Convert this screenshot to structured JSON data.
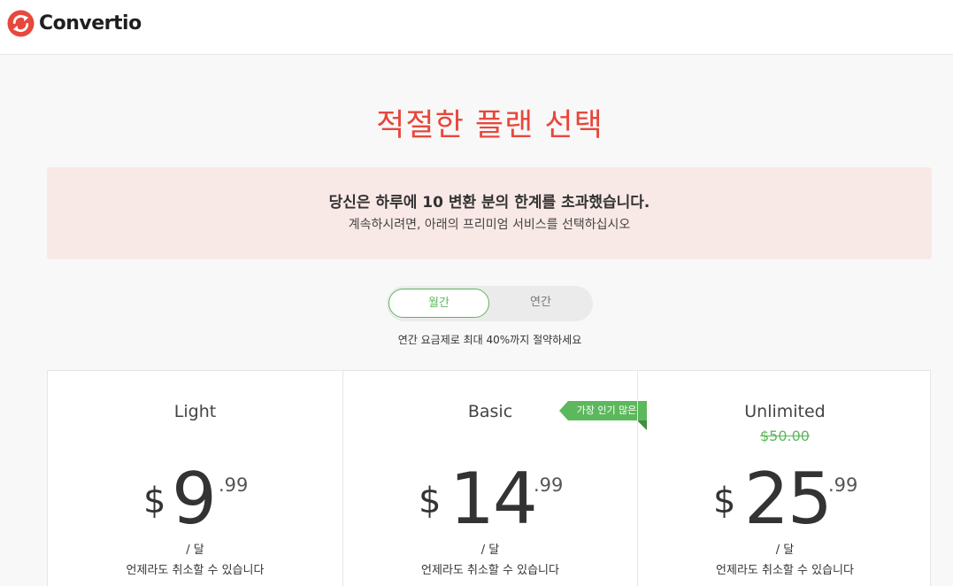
{
  "brand": {
    "name": "Convertio",
    "color": "#e8473c"
  },
  "page": {
    "title": "적절한 플랜 선택"
  },
  "alert": {
    "title": "당신은 하루에 10 변환 분의 한계를 초과했습니다.",
    "subtitle": "계속하시려면, 아래의 프리미엄 서비스를 선택하십시오"
  },
  "billing_toggle": {
    "monthly": "월간",
    "annual": "연간",
    "selected": "월간",
    "savings_text": "연간 요금제로 최대 40%까지 절약하세요"
  },
  "plans": [
    {
      "name": "Light",
      "currency": "$",
      "amount": "9",
      "cents": ".99",
      "per": "/ 달",
      "cancel": "언제라도 취소할 수 있습니다"
    },
    {
      "name": "Basic",
      "badge": "가장 인기 많은",
      "currency": "$",
      "amount": "14",
      "cents": ".99",
      "per": "/ 달",
      "cancel": "언제라도 취소할 수 있습니다"
    },
    {
      "name": "Unlimited",
      "old_price": "$50.00",
      "currency": "$",
      "amount": "25",
      "cents": ".99",
      "per": "/ 달",
      "cancel": "언제라도 취소할 수 있습니다"
    }
  ],
  "colors": {
    "accent_green": "#5cb85c",
    "title_red": "#e8473c",
    "alert_bg": "#f9e9e6"
  }
}
